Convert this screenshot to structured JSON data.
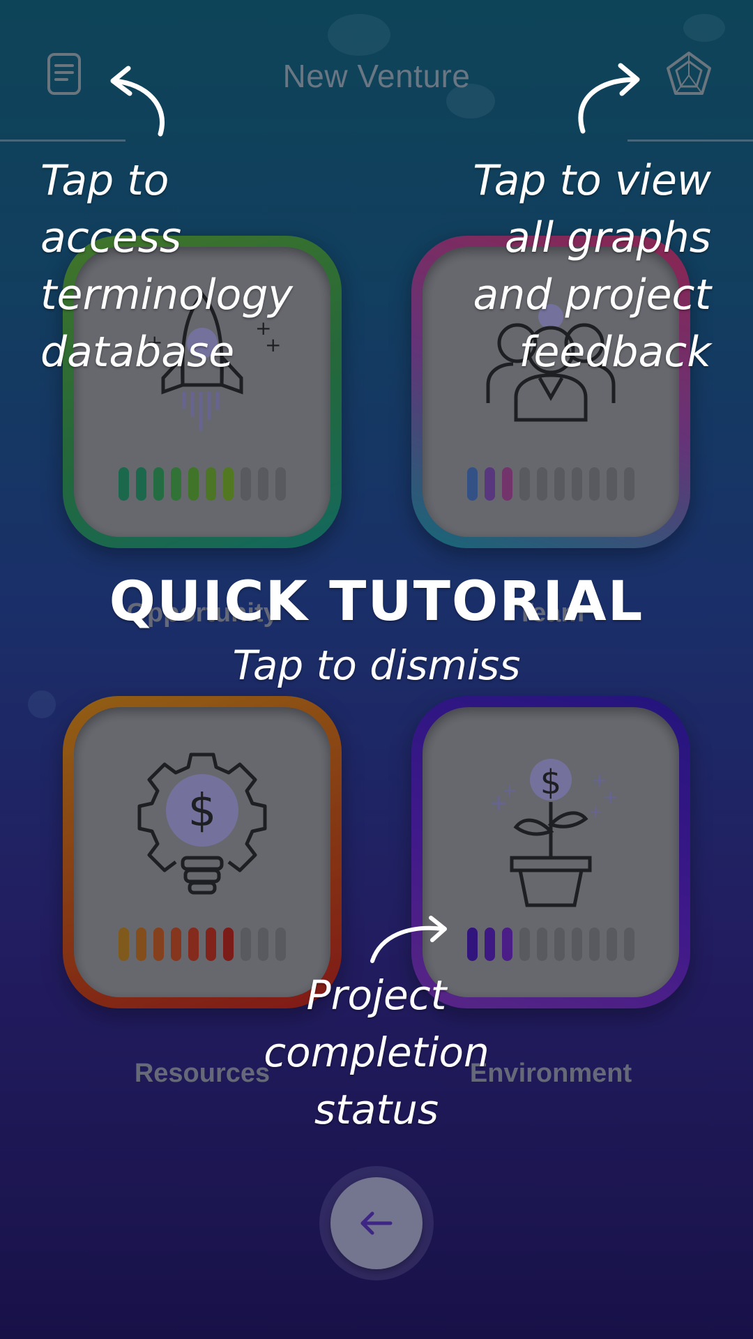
{
  "header": {
    "title": "New Venture"
  },
  "cards": [
    {
      "label": "Opportunity",
      "icon": "rocket-icon",
      "progress_filled": 7,
      "progress_total": 10,
      "colors": [
        "#1f7a55",
        "#1f7a55",
        "#2a8048",
        "#3a883a",
        "#4c8a2a",
        "#5b8c25",
        "#628e22"
      ]
    },
    {
      "label": "Team",
      "icon": "team-icon",
      "progress_filled": 3,
      "progress_total": 10,
      "colors": [
        "#3d5f9c",
        "#6a3f93",
        "#8a3a7a"
      ]
    },
    {
      "label": "Resources",
      "icon": "idea-gear-icon",
      "progress_filled": 7,
      "progress_total": 10,
      "colors": [
        "#9a6a1a",
        "#9f5a1a",
        "#a04a1c",
        "#a03d1c",
        "#9f301c",
        "#9b2618",
        "#951e16"
      ]
    },
    {
      "label": "Environment",
      "icon": "money-plant-icon",
      "progress_filled": 3,
      "progress_total": 10,
      "colors": [
        "#3a1590",
        "#4a1a98",
        "#5a1f9c"
      ]
    }
  ],
  "tutorial": {
    "left_hint": "Tap to access terminology database",
    "right_hint": "Tap to view all graphs and project feedback",
    "heading": "QUICK TUTORIAL",
    "dismiss": "Tap to dismiss",
    "status_hint": "Project completion status"
  },
  "nav": {
    "back_icon": "arrow-left-icon"
  }
}
